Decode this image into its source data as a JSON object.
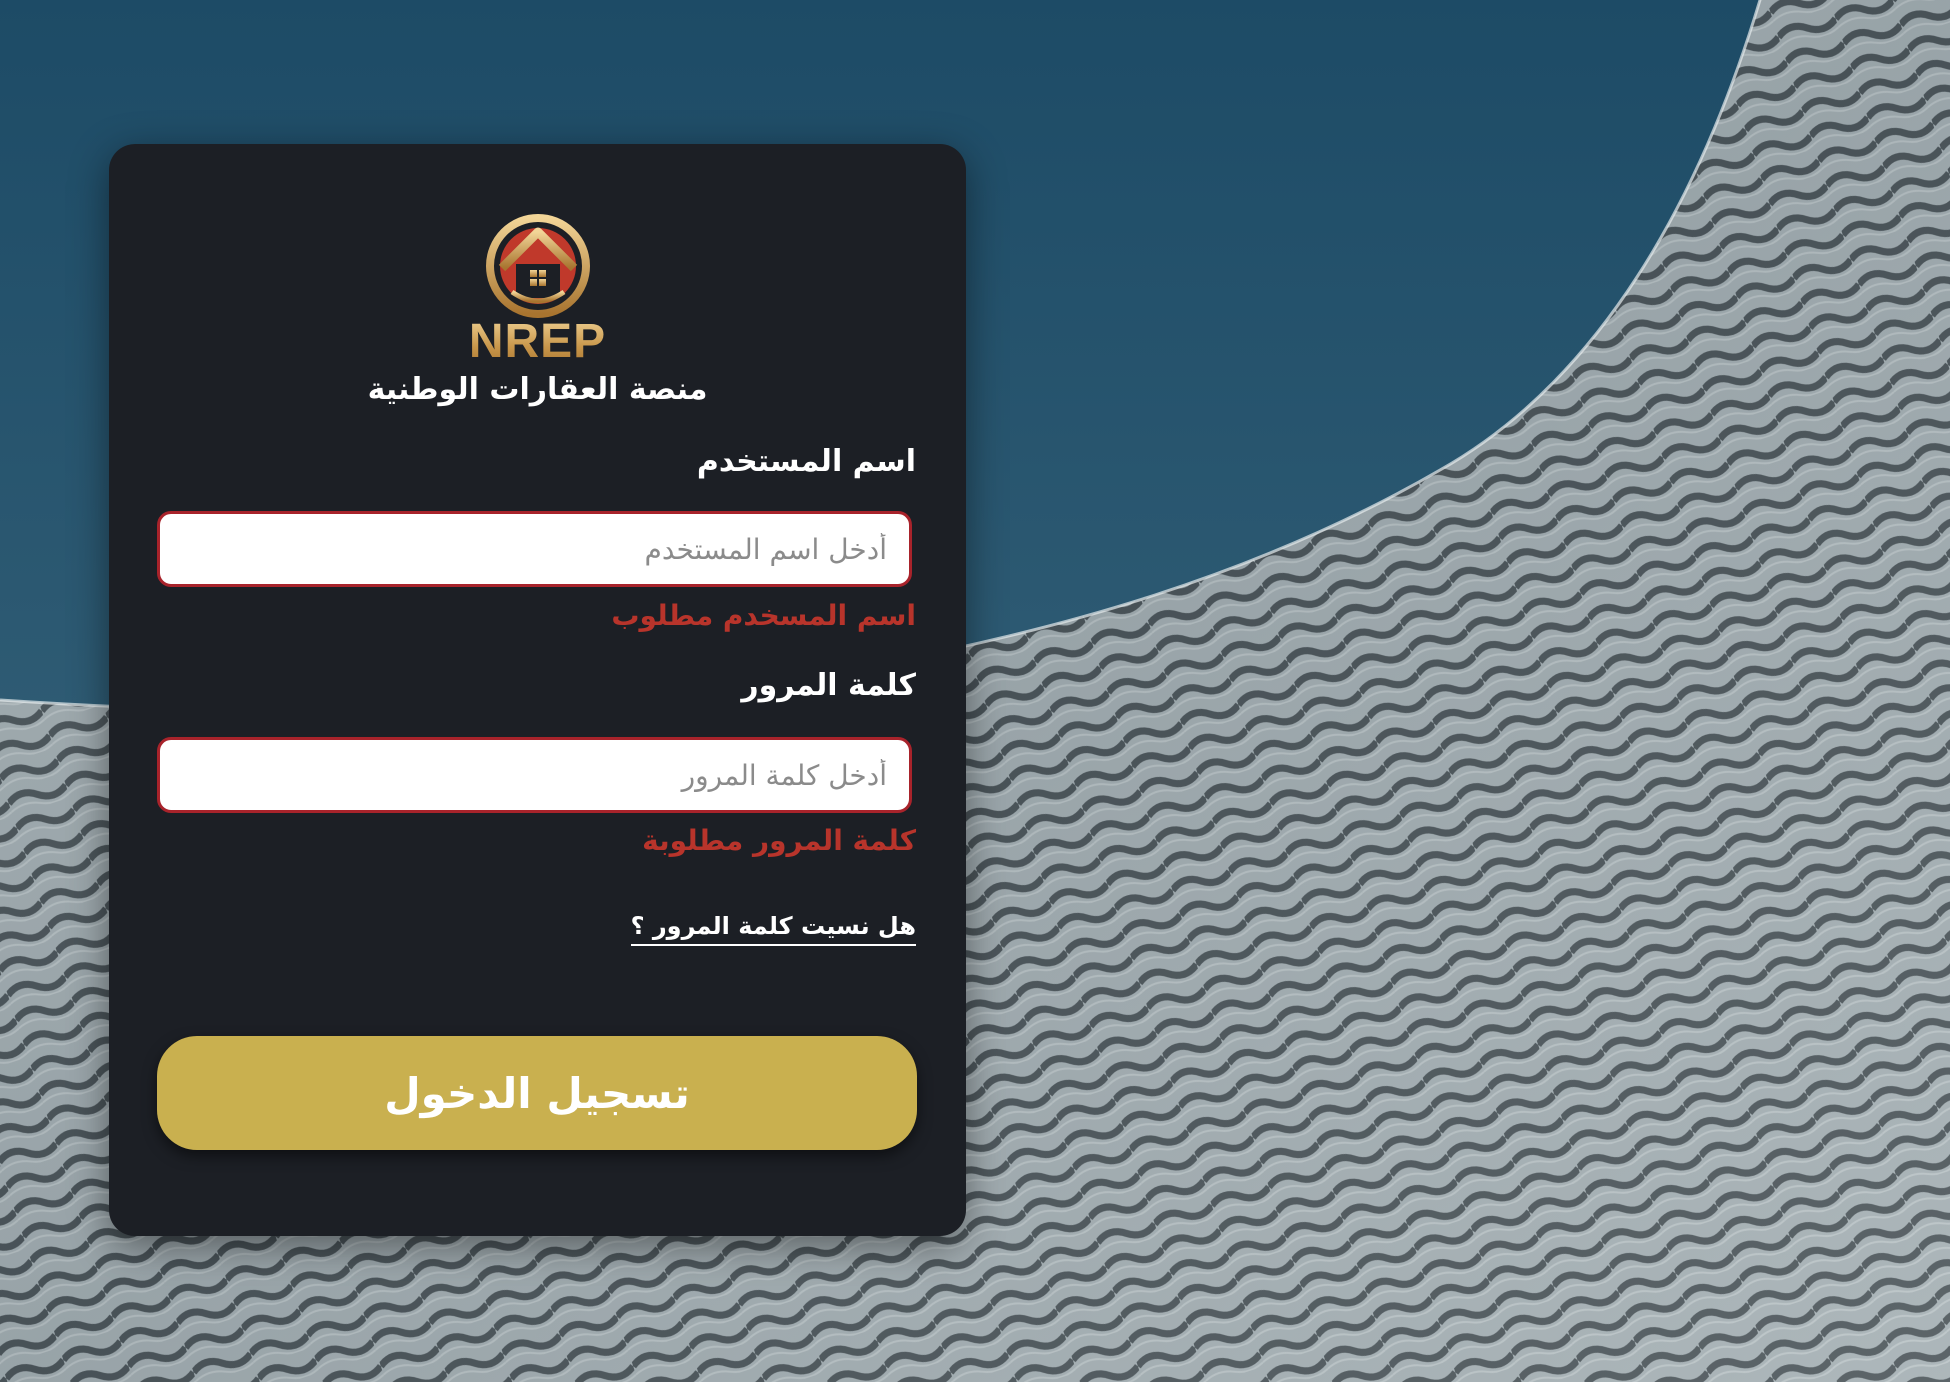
{
  "brand": {
    "logo_text": "NREP",
    "platform_name": "منصة العقارات الوطنية"
  },
  "form": {
    "username": {
      "label": "اسم المستخدم",
      "placeholder": "أدخل اسم المستخدم",
      "value": "",
      "error": "اسم المسخدم مطلوب"
    },
    "password": {
      "label": "كلمة المرور",
      "placeholder": "أدخل كلمة المرور",
      "value": "",
      "error": "كلمة المرور مطلوبة"
    },
    "forgot_password": "هل نسيت كلمة المرور ؟",
    "submit_label": "تسجيل الدخول"
  },
  "icons": {
    "logo": "house-in-circle-logo-icon"
  },
  "colors": {
    "card_background": "#1c1f25",
    "error": "#b8342b",
    "input_border_error": "#a8232b",
    "button": "#c9b04f",
    "brand_gold": "#d9b46a"
  }
}
